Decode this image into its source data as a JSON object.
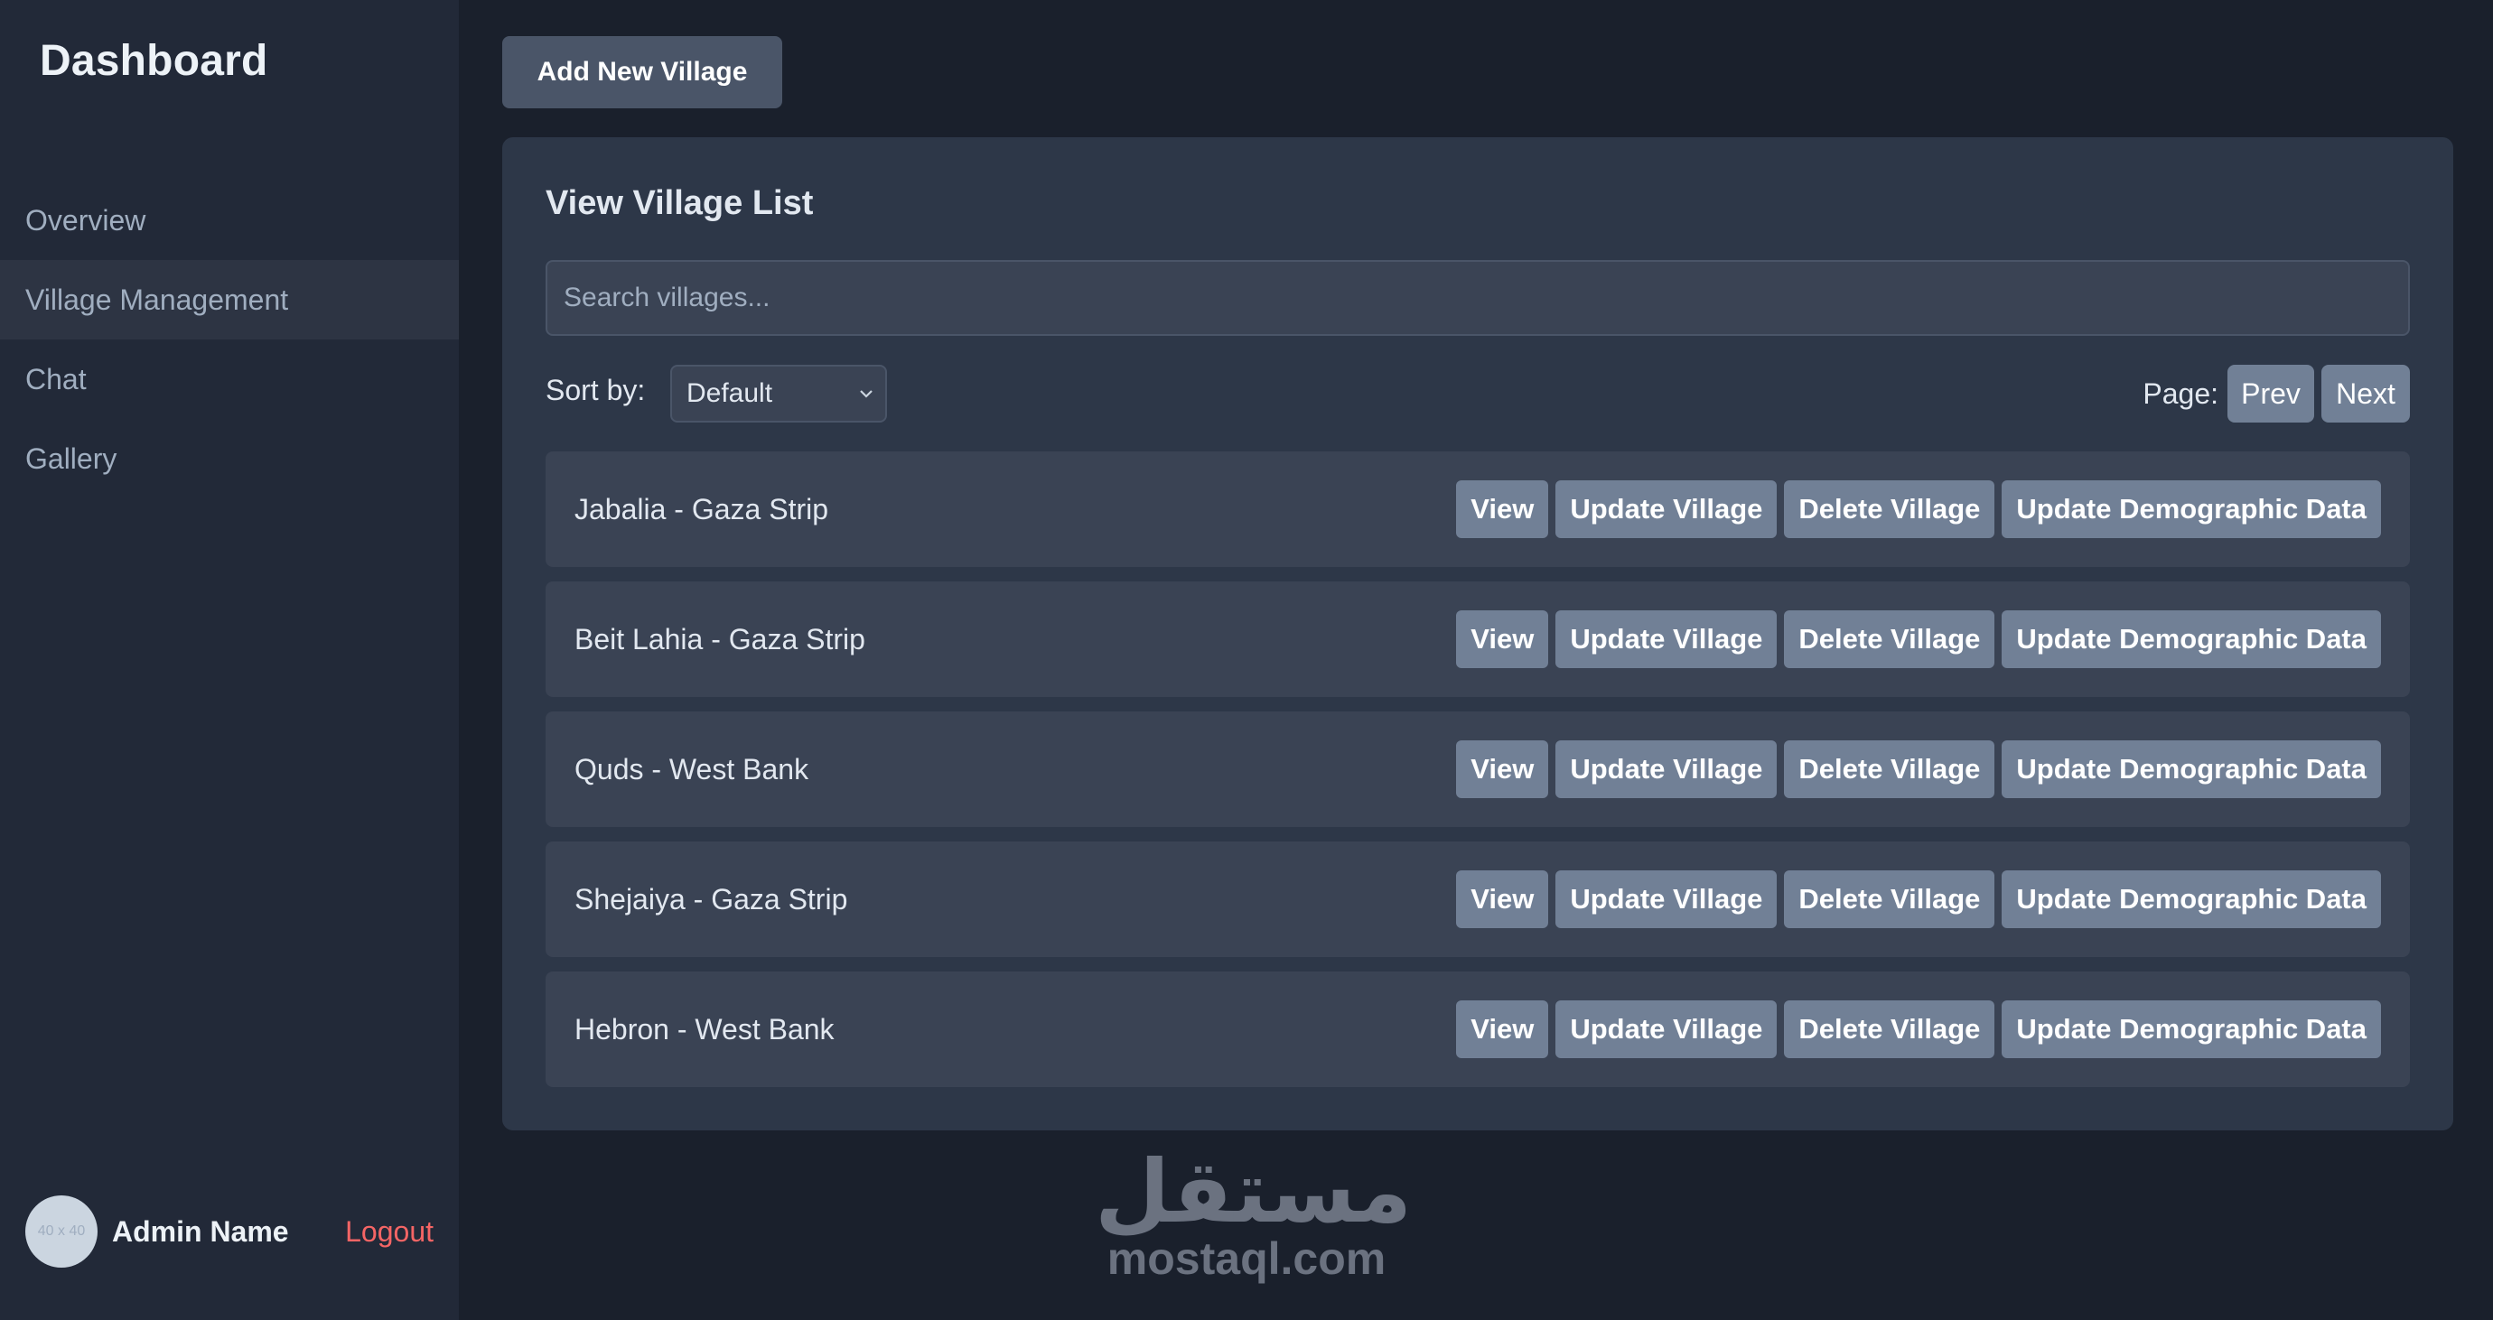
{
  "sidebar": {
    "brand": "Dashboard",
    "items": [
      {
        "label": "Overview"
      },
      {
        "label": "Village Management"
      },
      {
        "label": "Chat"
      },
      {
        "label": "Gallery"
      }
    ],
    "active_index": 1,
    "user": {
      "avatar_text": "40 x 40",
      "name": "Admin Name",
      "logout": "Logout"
    }
  },
  "main": {
    "add_button": "Add New Village",
    "panel": {
      "title": "View Village List",
      "search": {
        "placeholder": "Search villages...",
        "value": ""
      },
      "sort": {
        "label": "Sort by:",
        "selected": "Default"
      },
      "pagination": {
        "label": "Page:",
        "prev": "Prev",
        "next": "Next"
      },
      "actions": {
        "view": "View",
        "update": "Update Village",
        "delete": "Delete Village",
        "demographic": "Update Demographic Data"
      },
      "villages": [
        {
          "name": "Jabalia - Gaza Strip"
        },
        {
          "name": "Beit Lahia - Gaza Strip"
        },
        {
          "name": "Quds - West Bank"
        },
        {
          "name": "Shejaiya - Gaza Strip"
        },
        {
          "name": "Hebron - West Bank"
        }
      ]
    }
  },
  "watermark": {
    "arabic": "مستقل",
    "latin": "mostaql.com"
  },
  "colors": {
    "background": "#1a202c",
    "sidebar": "#222938",
    "panel": "#2d3748",
    "row": "#3a4354",
    "button": "#718096",
    "logout": "#f56565"
  }
}
